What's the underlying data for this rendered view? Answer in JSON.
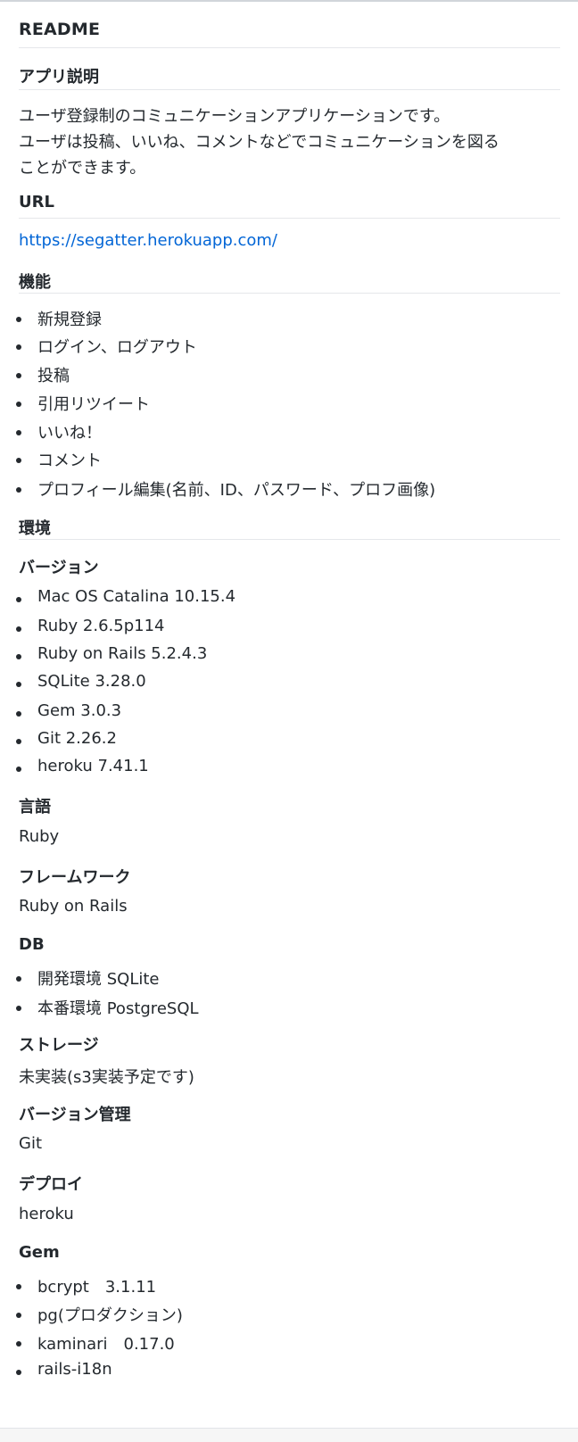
{
  "readme": {
    "title": "README",
    "app": {
      "heading": "アプリ説明",
      "lines": [
        "ユーザ登録制のコミュニケーションアプリケーションです。",
        "ユーザは投稿、いいね、コメントなどでコミュニケーションを図る",
        "ことができます。"
      ]
    },
    "url": {
      "heading": "URL",
      "link": "https://segatter.herokuapp.com/"
    },
    "features": {
      "heading": "機能",
      "items": [
        "新規登録",
        "ログイン、ログアウト",
        "投稿",
        "引用リツイート",
        "いいね！",
        "コメント",
        "プロフィール編集(名前、ID、パスワード、プロフ画像)"
      ]
    },
    "env": {
      "heading": "環境",
      "version": {
        "heading": "バージョン",
        "items": [
          "Mac OS Catalina 10.15.4",
          "Ruby 2.6.5p114",
          "Ruby on Rails 5.2.4.3",
          "SQLite 3.28.0",
          "Gem 3.0.3",
          "Git 2.26.2",
          "heroku 7.41.1"
        ]
      },
      "language": {
        "heading": "言語",
        "value": "Ruby"
      },
      "framework": {
        "heading": "フレームワーク",
        "value": "Ruby on Rails"
      },
      "db": {
        "heading": "DB",
        "items": [
          "開発環境 SQLite",
          "本番環境 PostgreSQL"
        ]
      },
      "storage": {
        "heading": "ストレージ",
        "value": "未実装(s3実装予定です)"
      },
      "vcs": {
        "heading": "バージョン管理",
        "value": "Git"
      },
      "deploy": {
        "heading": "デプロイ",
        "value": "heroku"
      },
      "gem": {
        "heading": "Gem",
        "items": [
          "bcrypt　3.1.11",
          "pg(プロダクション)",
          "kaminari　0.17.0",
          "rails-i18n"
        ]
      }
    }
  }
}
